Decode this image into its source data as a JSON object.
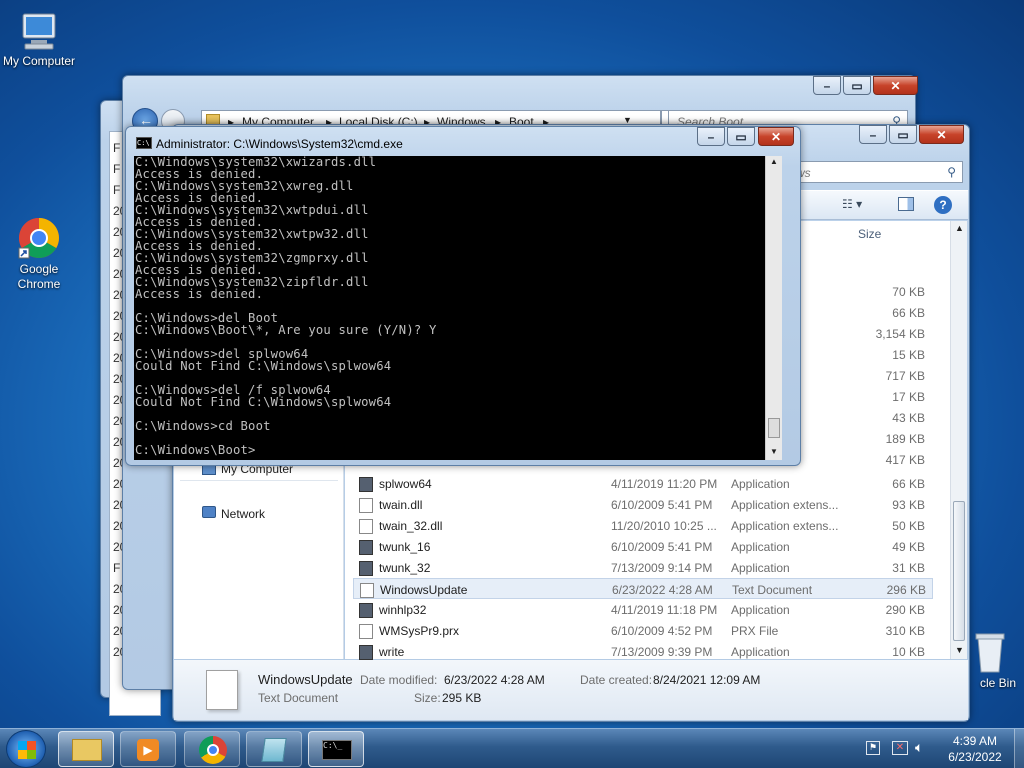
{
  "desktop": {
    "icons": [
      {
        "label": "My Computer"
      },
      {
        "label": "Google\nChrome"
      },
      {
        "label": "cle Bin"
      }
    ]
  },
  "back_explorer": {
    "address": [
      "My Computer",
      "Local Disk (C:)",
      "Windows",
      "Boot"
    ],
    "search_placeholder": "Search Boot",
    "left_chars": [
      "F",
      "F",
      "F",
      "20",
      "20",
      "20",
      "20",
      "20",
      "20",
      "20",
      "20",
      "20",
      "20",
      "20",
      "20",
      "20",
      "20",
      "20",
      "20",
      "20",
      "F",
      "20",
      "20",
      "20",
      "20"
    ]
  },
  "front_explorer": {
    "search_placeholder": "ws",
    "column_size": "Size",
    "nav_items": [
      {
        "label": "My Computer"
      },
      {
        "label": "Network"
      }
    ],
    "size_only_rows": [
      "70 KB",
      "66 KB",
      "3,154 KB",
      "15 KB",
      "717 KB",
      "17 KB",
      "43 KB",
      "189 KB",
      "417 KB"
    ],
    "files": [
      {
        "name": "splwow64",
        "date": "4/11/2019 11:20 PM",
        "type": "Application",
        "size": "66 KB"
      },
      {
        "name": "twain.dll",
        "date": "6/10/2009 5:41 PM",
        "type": "Application extens...",
        "size": "93 KB"
      },
      {
        "name": "twain_32.dll",
        "date": "11/20/2010 10:25 ...",
        "type": "Application extens...",
        "size": "50 KB"
      },
      {
        "name": "twunk_16",
        "date": "6/10/2009 5:41 PM",
        "type": "Application",
        "size": "49 KB"
      },
      {
        "name": "twunk_32",
        "date": "7/13/2009 9:14 PM",
        "type": "Application",
        "size": "31 KB"
      },
      {
        "name": "WindowsUpdate",
        "date": "6/23/2022 4:28 AM",
        "type": "Text Document",
        "size": "296 KB",
        "selected": true
      },
      {
        "name": "winhlp32",
        "date": "4/11/2019 11:18 PM",
        "type": "Application",
        "size": "290 KB"
      },
      {
        "name": "WMSysPr9.prx",
        "date": "6/10/2009 4:52 PM",
        "type": "PRX File",
        "size": "310 KB"
      },
      {
        "name": "write",
        "date": "7/13/2009 9:39 PM",
        "type": "Application",
        "size": "10 KB"
      }
    ],
    "details": {
      "name": "WindowsUpdate",
      "type": "Text Document",
      "modified_label": "Date modified:",
      "modified_value": "6/23/2022 4:28 AM",
      "created_label": "Date created:",
      "created_value": "8/24/2021 12:09 AM",
      "size_label": "Size:",
      "size_value": "295 KB"
    }
  },
  "cmd": {
    "title": "Administrator: C:\\Windows\\System32\\cmd.exe",
    "lines": [
      "C:\\Windows\\system32\\xwizards.dll",
      "Access is denied.",
      "C:\\Windows\\system32\\xwreg.dll",
      "Access is denied.",
      "C:\\Windows\\system32\\xwtpdui.dll",
      "Access is denied.",
      "C:\\Windows\\system32\\xwtpw32.dll",
      "Access is denied.",
      "C:\\Windows\\system32\\zgmprxy.dll",
      "Access is denied.",
      "C:\\Windows\\system32\\zipfldr.dll",
      "Access is denied.",
      "",
      "C:\\Windows>del Boot",
      "C:\\Windows\\Boot\\*, Are you sure (Y/N)? Y",
      "",
      "C:\\Windows>del splwow64",
      "Could Not Find C:\\Windows\\splwow64",
      "",
      "C:\\Windows>del /f splwow64",
      "Could Not Find C:\\Windows\\splwow64",
      "",
      "C:\\Windows>cd Boot",
      "",
      "C:\\Windows\\Boot>"
    ]
  },
  "taskbar": {
    "clock_time": "4:39 AM",
    "clock_date": "6/23/2022"
  }
}
